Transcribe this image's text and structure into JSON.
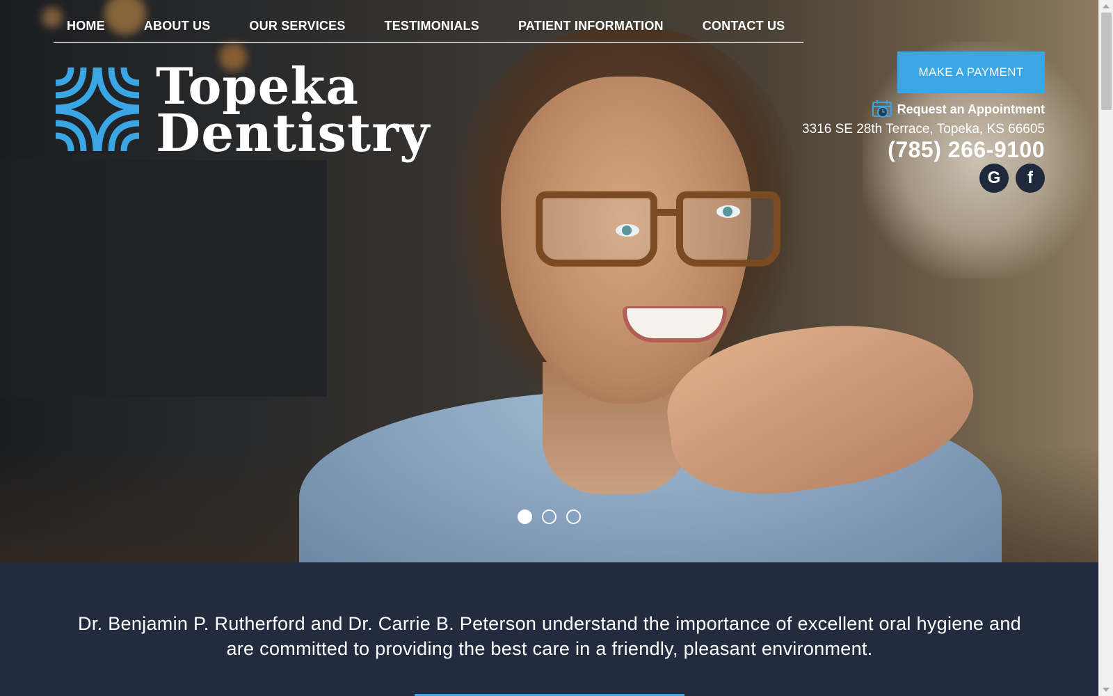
{
  "nav": {
    "items": [
      {
        "label": "HOME"
      },
      {
        "label": "ABOUT US"
      },
      {
        "label": "OUR SERVICES"
      },
      {
        "label": "TESTIMONIALS"
      },
      {
        "label": "PATIENT INFORMATION"
      },
      {
        "label": "CONTACT US"
      }
    ]
  },
  "logo": {
    "line1": "Topeka",
    "line2": "Dentistry",
    "color": "#3aa7e4"
  },
  "header_right": {
    "payment_label": "MAKE A PAYMENT",
    "appointment_label": "Request an Appointment",
    "appointment_icon": "calendar-clock-icon",
    "address": "3316 SE 28th Terrace, Topeka, KS 66605",
    "phone": "(785) 266-9100",
    "social": [
      {
        "name": "google-icon",
        "glyph": "G"
      },
      {
        "name": "facebook-icon",
        "glyph": "f"
      }
    ]
  },
  "hero": {
    "active_slide": 1,
    "slide_count": 3
  },
  "intro": {
    "text": "Dr. Benjamin P. Rutherford and Dr. Carrie B. Peterson understand the importance of excellent oral hygiene and are committed to providing the best care in a friendly, pleasant environment."
  },
  "colors": {
    "accent": "#3aa7e4",
    "dark_navy": "#232c3e"
  }
}
